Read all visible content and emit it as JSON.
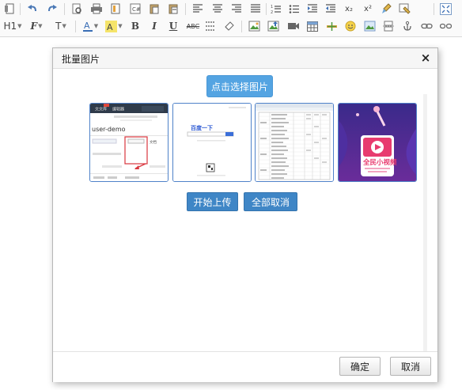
{
  "toolbar": {
    "heading_label": "H1",
    "font_family_label": "F",
    "font_size_label": "T",
    "bold_label": "B",
    "italic_label": "I",
    "underline_label": "U",
    "strike_label": "ABC",
    "superscript_label": "x²",
    "subscript_label": "x₂",
    "row1_icons": [
      "source-icon",
      "undo-icon",
      "redo-icon",
      "find-icon",
      "print-icon",
      "template-icon",
      "code-icon",
      "paste-icon",
      "paste-text-icon",
      "align-left-icon",
      "align-center-icon",
      "align-right-icon",
      "align-justify-icon",
      "ordered-list-icon",
      "unordered-list-icon",
      "indent-icon",
      "outdent-icon",
      "subscript-icon",
      "superscript-icon",
      "clear-format-icon",
      "format-painter-icon",
      "fullscreen-icon"
    ],
    "row2_icons": [
      "heading-icon",
      "font-family-icon",
      "font-size-icon",
      "font-color-icon",
      "highlight-icon",
      "bold-icon",
      "italic-icon",
      "underline-icon",
      "strikethrough-icon",
      "line-spacing-icon",
      "eraser-icon",
      "insert-image-icon",
      "upload-image-icon",
      "video-icon",
      "table-icon",
      "insert-row-icon",
      "emoji-icon",
      "gallery-icon",
      "page-break-icon",
      "anchor-icon",
      "link-icon",
      "unlink-icon"
    ]
  },
  "dialog": {
    "title": "批量图片",
    "close_label": "×",
    "select_button": "点击选择图片",
    "start_upload": "开始上传",
    "cancel_all": "全部取消",
    "confirm": "确定",
    "cancel": "取消",
    "thumbnails": [
      {
        "name": "screenshot-github",
        "texts": [
          "文文库",
          "编辑器",
          "user-demo",
          "文档"
        ]
      },
      {
        "name": "screenshot-baidu",
        "texts": [
          "百度一下"
        ]
      },
      {
        "name": "screenshot-table",
        "texts": []
      },
      {
        "name": "screenshot-app",
        "texts": [
          "全民小视频"
        ]
      }
    ]
  },
  "colors": {
    "select_button": "#54a4e2",
    "upload_buttons": "#3f86c6",
    "thumb_border": "#4f82c9"
  }
}
